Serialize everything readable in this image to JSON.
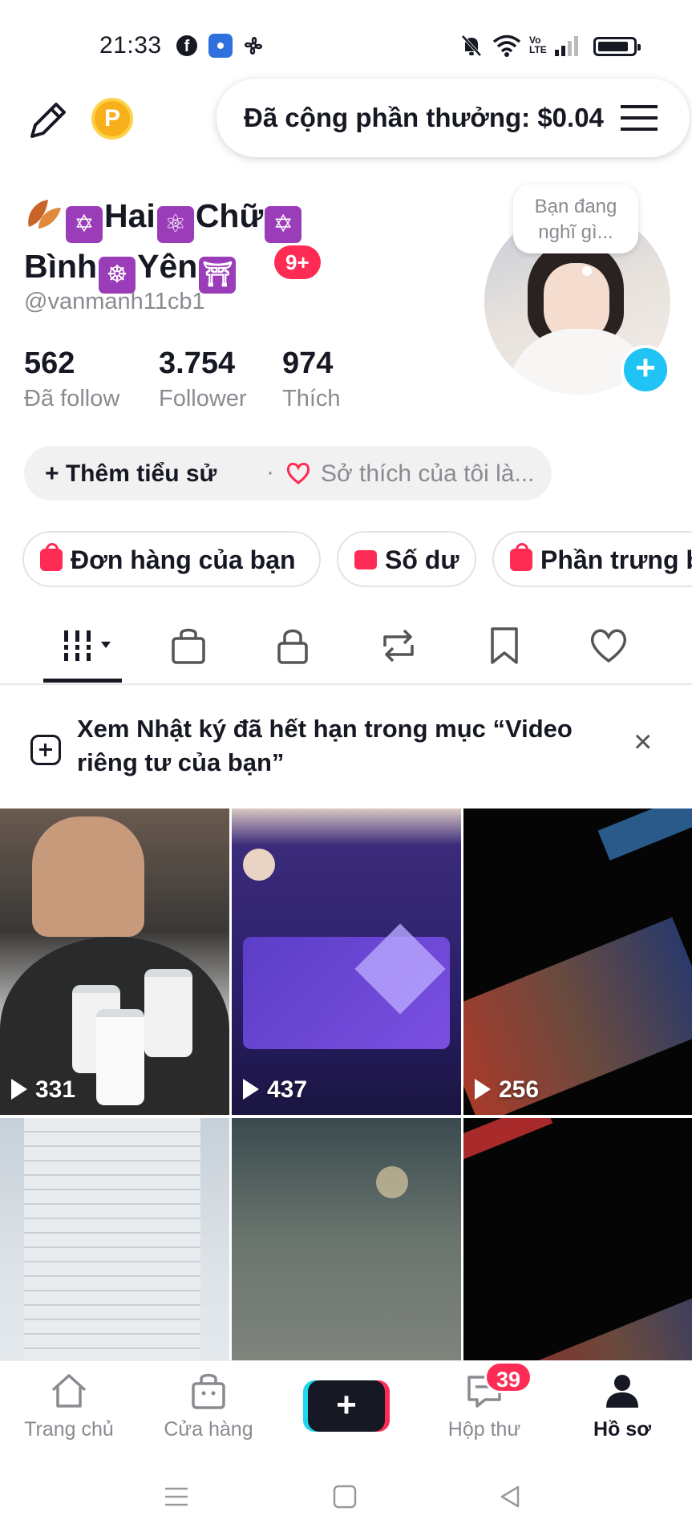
{
  "status_bar": {
    "time": "21:33",
    "network": "Vo LTE"
  },
  "top_bar": {
    "reward_text": "Đã cộng phần thưởng: $0.04",
    "coin_label": "P"
  },
  "profile": {
    "name_line1": "Hai",
    "name_line1b": "Chữ",
    "name_line2": "Bình",
    "name_line2b": "Yên",
    "notification_badge": "9+",
    "username": "@vanmanh11cb1",
    "thought_bubble": "Bạn đang nghĩ gì...",
    "stats": [
      {
        "value": "562",
        "label": "Đã follow"
      },
      {
        "value": "3.754",
        "label": "Follower"
      },
      {
        "value": "974",
        "label": "Thích"
      }
    ],
    "bio_add": "Thêm tiểu sử",
    "bio_separator": "·",
    "bio_hint": "Sở thích của tôi là..."
  },
  "chips": [
    {
      "label": "Đơn hàng của bạn"
    },
    {
      "label": "Số dư"
    },
    {
      "label": "Phần trưng bày"
    }
  ],
  "tabs": [
    "videos",
    "shop",
    "private",
    "reposts",
    "favorites",
    "liked"
  ],
  "notice": {
    "text": "Xem Nhật ký đã hết hạn trong mục “Video riêng tư của bạn”",
    "close": "×"
  },
  "videos": [
    {
      "views": "331"
    },
    {
      "views": "437"
    },
    {
      "views": "256"
    },
    {
      "views": ""
    },
    {
      "views": ""
    },
    {
      "views": ""
    }
  ],
  "bottom_nav": {
    "items": [
      {
        "label": "Trang chủ"
      },
      {
        "label": "Cửa hàng"
      },
      {
        "label": "Hộp thư"
      },
      {
        "label": "Hồ sơ"
      }
    ],
    "create_label": "+",
    "inbox_badge": "39"
  },
  "colors": {
    "accent": "#fe2c55",
    "cyan": "#20d5ec",
    "text": "#161823",
    "muted": "#8a8b91"
  }
}
